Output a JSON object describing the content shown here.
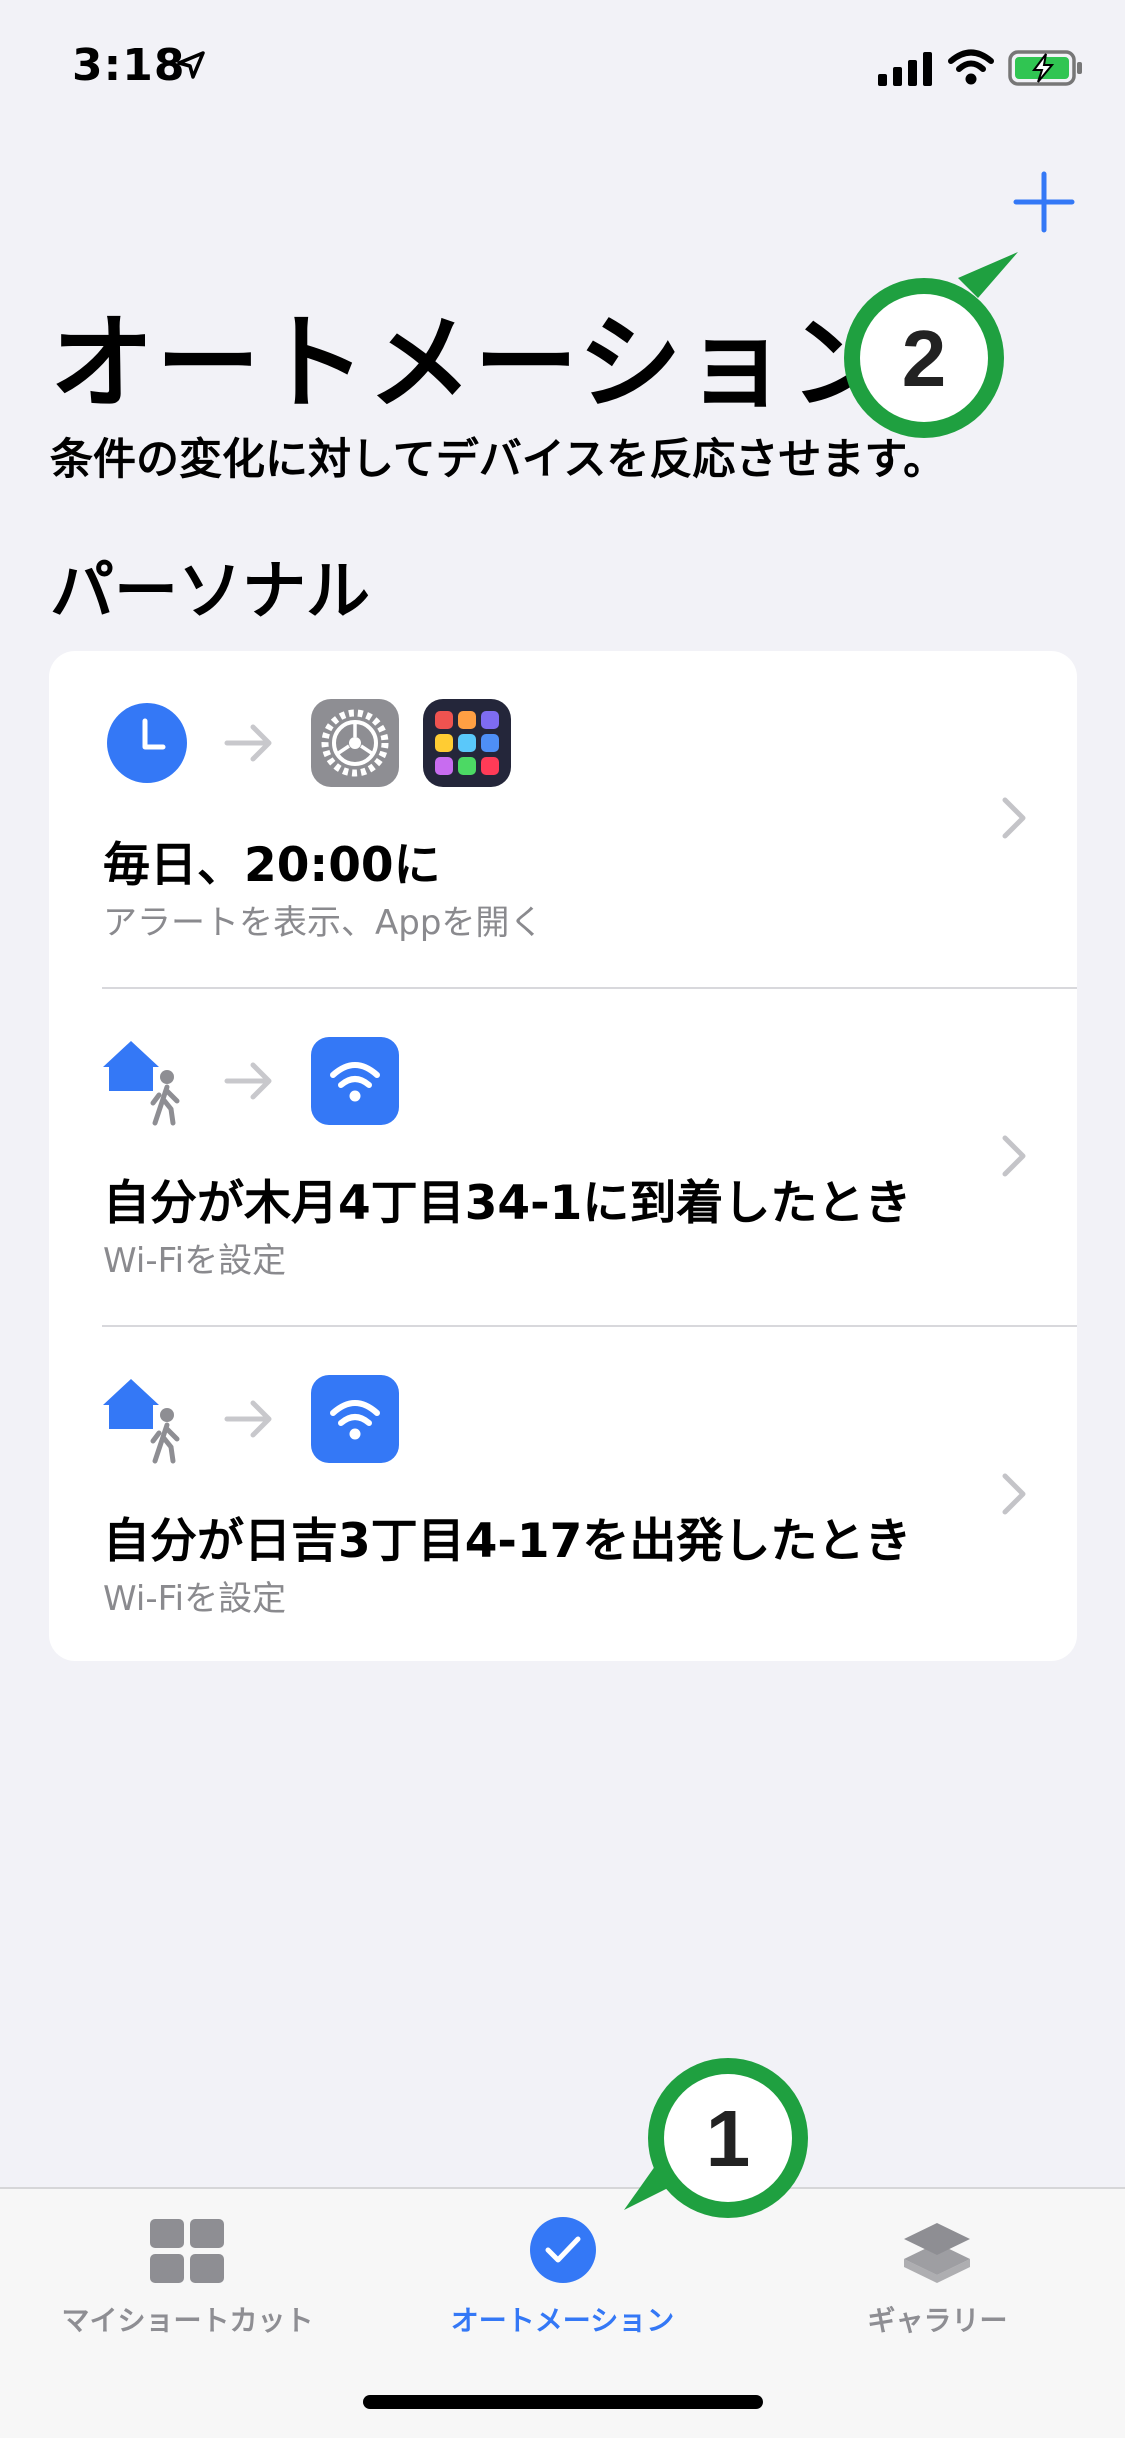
{
  "status_bar": {
    "time": "3:18"
  },
  "header": {
    "title": "オートメーション",
    "subtitle": "条件の変化に対してデバイスを反応させます。",
    "section": "パーソナル"
  },
  "automations": [
    {
      "title": "毎日、20:00に",
      "subtitle": "アラートを表示、Appを開く",
      "trigger_icon": "clock-icon",
      "action_icons": [
        "settings-app-icon",
        "app-grid-icon"
      ]
    },
    {
      "title": "自分が木月4丁目34-1に到着したとき",
      "subtitle": "Wi-Fiを設定",
      "trigger_icon": "home-person-icon",
      "action_icons": [
        "wifi-icon"
      ]
    },
    {
      "title": "自分が日吉3丁目4-17を出発したとき",
      "subtitle": "Wi-Fiを設定",
      "trigger_icon": "home-person-icon",
      "action_icons": [
        "wifi-icon"
      ]
    }
  ],
  "tabs": [
    {
      "label": "マイショートカット",
      "icon": "grid-icon",
      "active": false
    },
    {
      "label": "オートメーション",
      "icon": "checkmark-clock-icon",
      "active": true
    },
    {
      "label": "ギャラリー",
      "icon": "layers-icon",
      "active": false
    }
  ],
  "callouts": [
    {
      "number": "1"
    },
    {
      "number": "2"
    }
  ],
  "colors": {
    "accent": "#3478f6",
    "callout_border": "#1fa040",
    "background": "#f2f2f7"
  }
}
